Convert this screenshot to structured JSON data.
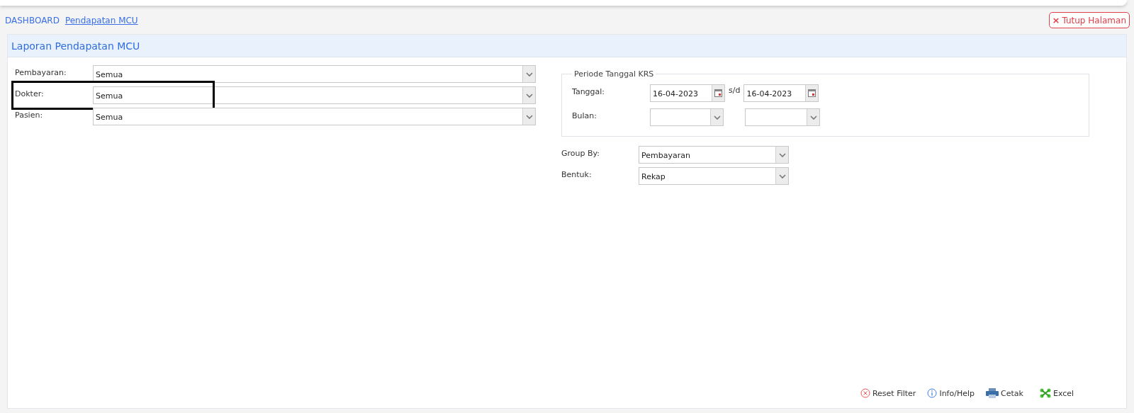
{
  "breadcrumb": [
    {
      "label": "DASHBOARD",
      "current": false
    },
    {
      "label": "Pendapatan MCU",
      "current": true
    }
  ],
  "close_button": {
    "icon": "×",
    "label": "Tutup Halaman"
  },
  "panel": {
    "title": "Laporan Pendapatan MCU"
  },
  "left_fields": [
    {
      "label": "Pembayaran:",
      "value": "Semua",
      "highlighted": false
    },
    {
      "label": "Dokter:",
      "value": "Semua",
      "highlighted": true
    },
    {
      "label": "Pasien:",
      "value": "Semua",
      "highlighted": false
    }
  ],
  "period": {
    "legend": "Periode Tanggal KRS",
    "date_label": "Tanggal:",
    "date_from": "16-04-2023",
    "separator": "s/d",
    "date_to": "16-04-2023",
    "month_label": "Bulan:"
  },
  "right_fields": [
    {
      "label": "Group By:",
      "value": "Pembayaran"
    },
    {
      "label": "Bentuk:",
      "value": "Rekap"
    }
  ],
  "actions": [
    {
      "kind": "reset",
      "label": "Reset Filter"
    },
    {
      "kind": "info",
      "label": "Info/Help"
    },
    {
      "kind": "print",
      "label": "Cetak"
    },
    {
      "kind": "excel",
      "label": "Excel"
    }
  ]
}
